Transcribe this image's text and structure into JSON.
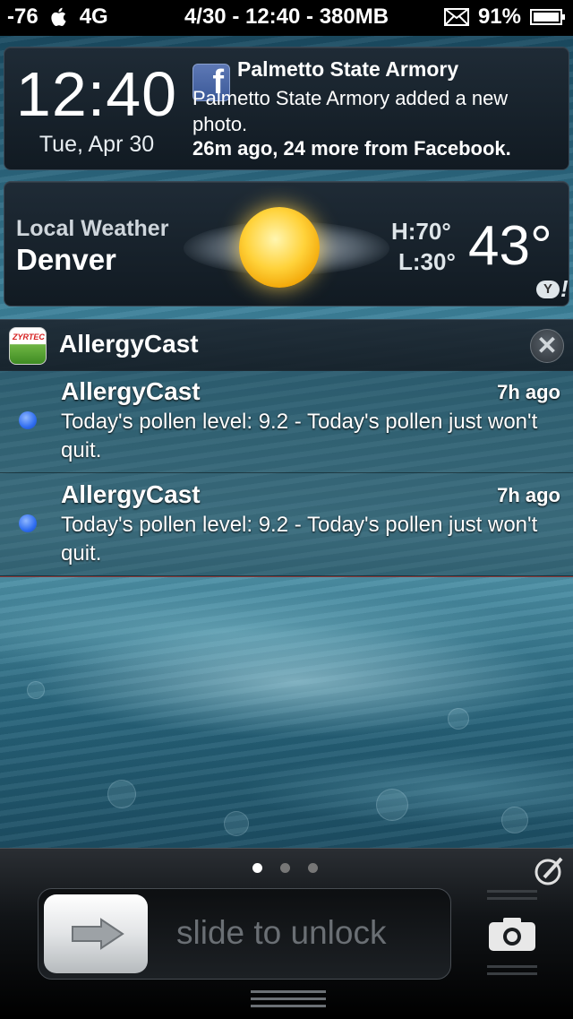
{
  "status_bar": {
    "signal": "-76",
    "network": "4G",
    "center": "4/30 - 12:40 - 380MB",
    "battery": "91%",
    "icons": [
      "apple-icon",
      "mail-icon",
      "battery-icon"
    ]
  },
  "clock": {
    "time": "12:40",
    "date": "Tue, Apr 30"
  },
  "facebook_notification": {
    "icon": "facebook-icon",
    "icon_glyph": "f",
    "title": "Palmetto State Armory",
    "text": "Palmetto State Armory added a new photo.",
    "meta": "26m ago, 24 more from Facebook."
  },
  "weather": {
    "label": "Local Weather",
    "city": "Denver",
    "high": "H:70°",
    "low": "L:30°",
    "temp": "43°",
    "provider_icon": "yahoo-icon",
    "provider_text": "Y",
    "provider_bang": "!",
    "condition_icon": "sun-cloud-icon"
  },
  "allergy_app": {
    "name": "AllergyCast",
    "icon_text": "ZYRTEC",
    "close_glyph": "✕",
    "notifications": [
      {
        "title": "AllergyCast",
        "time": "7h ago",
        "text": "Today's pollen level: 9.2 - Today's pollen just won't quit."
      },
      {
        "title": "AllergyCast",
        "time": "7h ago",
        "text": "Today's pollen level: 9.2 - Today's pollen just won't quit."
      }
    ]
  },
  "lock": {
    "slider_text": "slide to unlock",
    "page_count": 3,
    "active_page": 1
  }
}
